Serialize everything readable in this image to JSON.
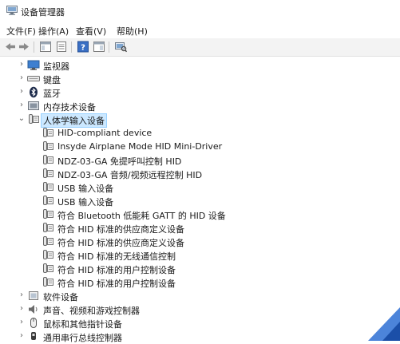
{
  "window": {
    "title": "设备管理器"
  },
  "menu": [
    "文件(F)",
    "操作(A)",
    "查看(V)",
    "帮助(H)"
  ],
  "tree": [
    {
      "label": "监视器",
      "level": 1,
      "expanded": false,
      "icon": "monitor-icon"
    },
    {
      "label": "键盘",
      "level": 1,
      "expanded": false,
      "icon": "keyboard-icon"
    },
    {
      "label": "蓝牙",
      "level": 1,
      "expanded": false,
      "icon": "bluetooth-icon"
    },
    {
      "label": "内存技术设备",
      "level": 1,
      "expanded": false,
      "icon": "memory-icon"
    },
    {
      "label": "人体学输入设备",
      "level": 1,
      "expanded": true,
      "selected": true,
      "icon": "hid-icon"
    },
    {
      "label": "HID-compliant device",
      "level": 2,
      "icon": "hid-icon"
    },
    {
      "label": "Insyde Airplane Mode HID Mini-Driver",
      "level": 2,
      "icon": "hid-icon"
    },
    {
      "label": "NDZ-03-GA 免提呼叫控制 HID",
      "level": 2,
      "icon": "hid-icon"
    },
    {
      "label": "NDZ-03-GA 音频/视频远程控制 HID",
      "level": 2,
      "icon": "hid-icon"
    },
    {
      "label": "USB 输入设备",
      "level": 2,
      "icon": "hid-icon"
    },
    {
      "label": "USB 输入设备",
      "level": 2,
      "icon": "hid-icon"
    },
    {
      "label": "符合 Bluetooth 低能耗 GATT 的 HID 设备",
      "level": 2,
      "icon": "hid-icon"
    },
    {
      "label": "符合 HID 标准的供应商定义设备",
      "level": 2,
      "icon": "hid-icon"
    },
    {
      "label": "符合 HID 标准的供应商定义设备",
      "level": 2,
      "icon": "hid-icon"
    },
    {
      "label": "符合 HID 标准的无线通信控制",
      "level": 2,
      "icon": "hid-icon"
    },
    {
      "label": "符合 HID 标准的用户控制设备",
      "level": 2,
      "icon": "hid-icon"
    },
    {
      "label": "符合 HID 标准的用户控制设备",
      "level": 2,
      "icon": "hid-icon"
    },
    {
      "label": "软件设备",
      "level": 1,
      "expanded": false,
      "icon": "software-device-icon"
    },
    {
      "label": "声音、视频和游戏控制器",
      "level": 1,
      "expanded": false,
      "icon": "speaker-icon"
    },
    {
      "label": "鼠标和其他指针设备",
      "level": 1,
      "expanded": false,
      "icon": "mouse-icon"
    },
    {
      "label": "通用串行总线控制器",
      "level": 1,
      "expanded": false,
      "icon": "usb-icon"
    }
  ]
}
